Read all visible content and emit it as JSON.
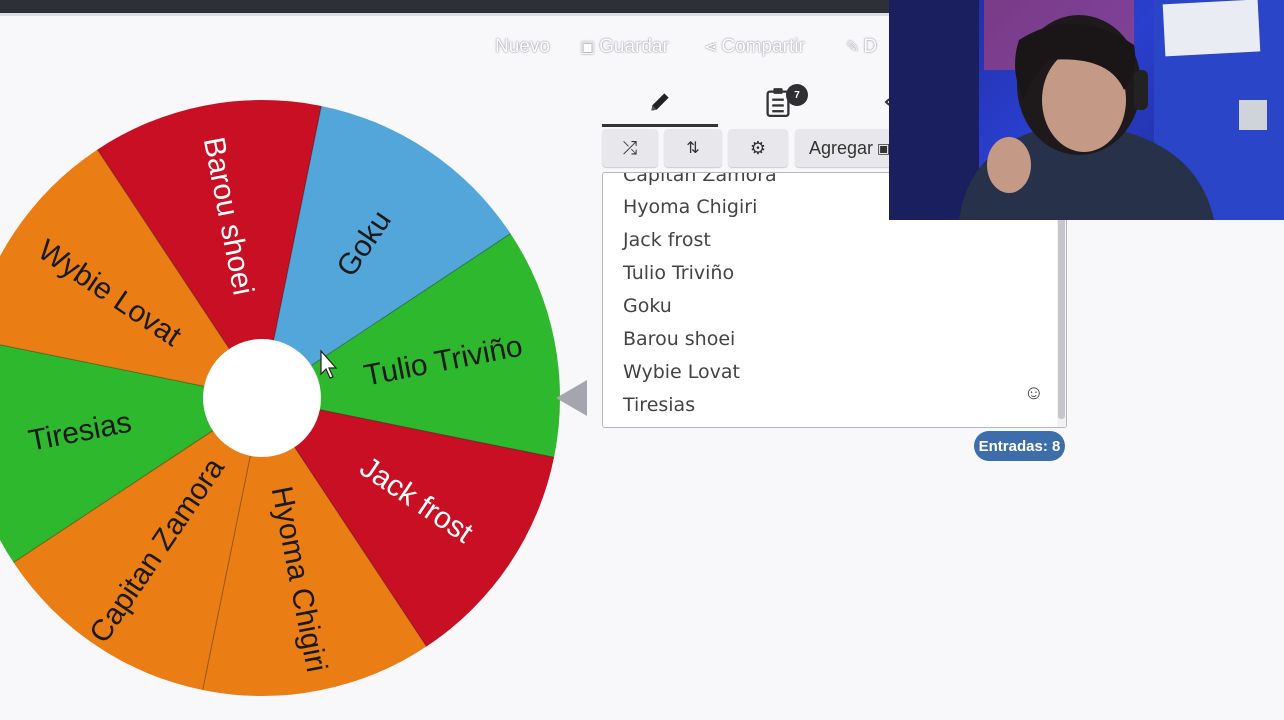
{
  "menu": {
    "new_label": "Nuevo",
    "save_label": "Guardar",
    "share_label": "Compartir",
    "cut_label": "D"
  },
  "tabs": [
    {
      "icon": "pencil-icon",
      "active": true
    },
    {
      "icon": "clipboard-list-icon",
      "badge": "7"
    },
    {
      "icon": "eye-icon"
    }
  ],
  "toolbar": {
    "shuffle_icon": "shuffle-icon",
    "sort_icon": "sort-icon",
    "settings_icon": "gear-icon",
    "add_label": "Agregar"
  },
  "entries": {
    "items": [
      "Capitan Zamora",
      "Hyoma Chigiri",
      "Jack frost",
      "Tulio Triviño",
      "Goku",
      "Barou shoei",
      "Wybie Lovat",
      "Tiresias"
    ],
    "count_label": "Entradas: 8"
  },
  "wheel": {
    "slices": [
      {
        "label": "Tulio Triviño",
        "color": "#2eb82e"
      },
      {
        "label": "Jack frost",
        "color": "#c80f23"
      },
      {
        "label": "Hyoma Chigiri",
        "color": "#ea7d14"
      },
      {
        "label": "Capitan Zamora",
        "color": "#ea7d14"
      },
      {
        "label": "Tiresias",
        "color": "#2eb82e"
      },
      {
        "label": "Wybie Lovat",
        "color": "#ea7d14"
      },
      {
        "label": "Barou shoei",
        "color": "#c80f23"
      },
      {
        "label": "Goku",
        "color": "#52a6d9"
      }
    ]
  },
  "colors": {
    "accent_badge": "#3e6dac",
    "pointer": "#a5a5ad"
  }
}
